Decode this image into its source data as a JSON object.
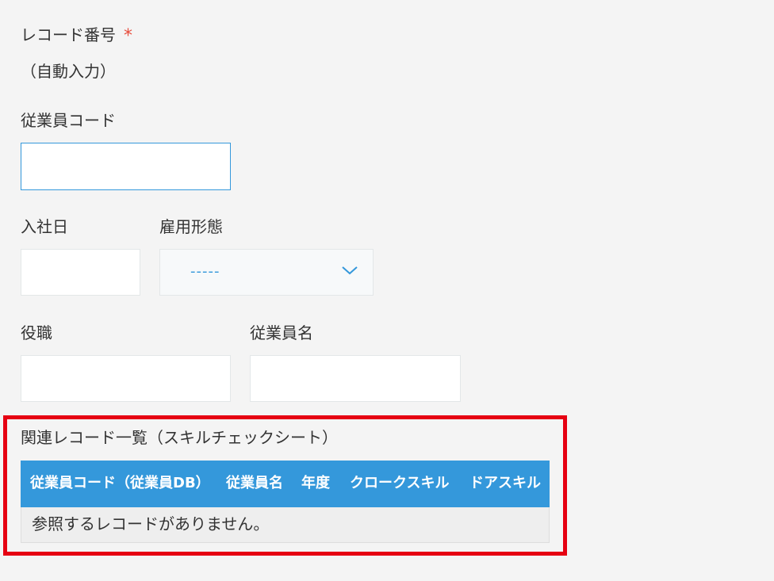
{
  "form": {
    "record_number": {
      "label": "レコード番号",
      "required_mark": "*",
      "value": "（自動入力）"
    },
    "employee_code": {
      "label": "従業員コード",
      "value": ""
    },
    "hire_date": {
      "label": "入社日",
      "value": ""
    },
    "employment_type": {
      "label": "雇用形態",
      "selected": "-----"
    },
    "position": {
      "label": "役職",
      "value": ""
    },
    "employee_name": {
      "label": "従業員名",
      "value": ""
    }
  },
  "related_records": {
    "title": "関連レコード一覧（スキルチェックシート）",
    "columns": [
      "従業員コード（従業員DB）",
      "従業員名",
      "年度",
      "クロークスキル",
      "ドアスキル"
    ],
    "empty_message": "参照するレコードがありません。"
  },
  "colors": {
    "accent": "#3498db",
    "required": "#e74c3c",
    "highlight": "#e60012"
  },
  "icons": {
    "dropdown": "chevron-down-icon"
  }
}
